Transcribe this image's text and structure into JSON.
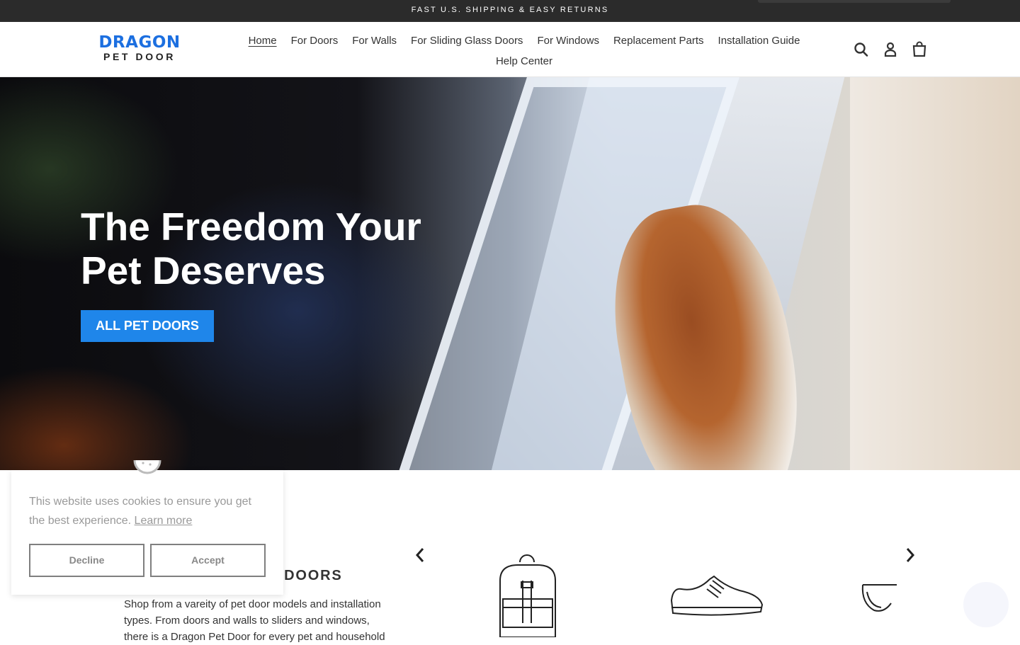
{
  "announcement": {
    "text": "FAST U.S. SHIPPING & EASY RETURNS"
  },
  "logo": {
    "line1": "DRAGON",
    "line2": "PET DOOR"
  },
  "nav": {
    "items": [
      {
        "label": "Home",
        "active": true
      },
      {
        "label": "For Doors"
      },
      {
        "label": "For Walls"
      },
      {
        "label": "For Sliding Glass Doors"
      },
      {
        "label": "For Windows"
      },
      {
        "label": "Replacement Parts"
      },
      {
        "label": "Installation Guide"
      },
      {
        "label": "Help Center"
      }
    ]
  },
  "header_icons": [
    "search-icon",
    "account-icon",
    "cart-icon"
  ],
  "hero": {
    "title_line1": "The Freedom Your",
    "title_line2": "Pet Deserves",
    "button_label": "ALL PET DOORS"
  },
  "featured": {
    "title": "BEST-SELLING PET DOORS",
    "text": "Shop from a vareity of pet door models and installation types. From doors and walls to sliders and windows, there is a Dragon Pet Door for every pet and household"
  },
  "carousel": {
    "products": [
      "backpack-icon",
      "sneaker-icon",
      "sunglasses-icon"
    ]
  },
  "cookie": {
    "message": "This website uses cookies to ensure you get the best experience.",
    "link": "Learn more",
    "decline": "Decline",
    "accept": "Accept"
  },
  "colors": {
    "brand_blue": "#1c6fe0",
    "button_blue": "#1f86ea",
    "announcement_bg": "#2b2b2b"
  }
}
